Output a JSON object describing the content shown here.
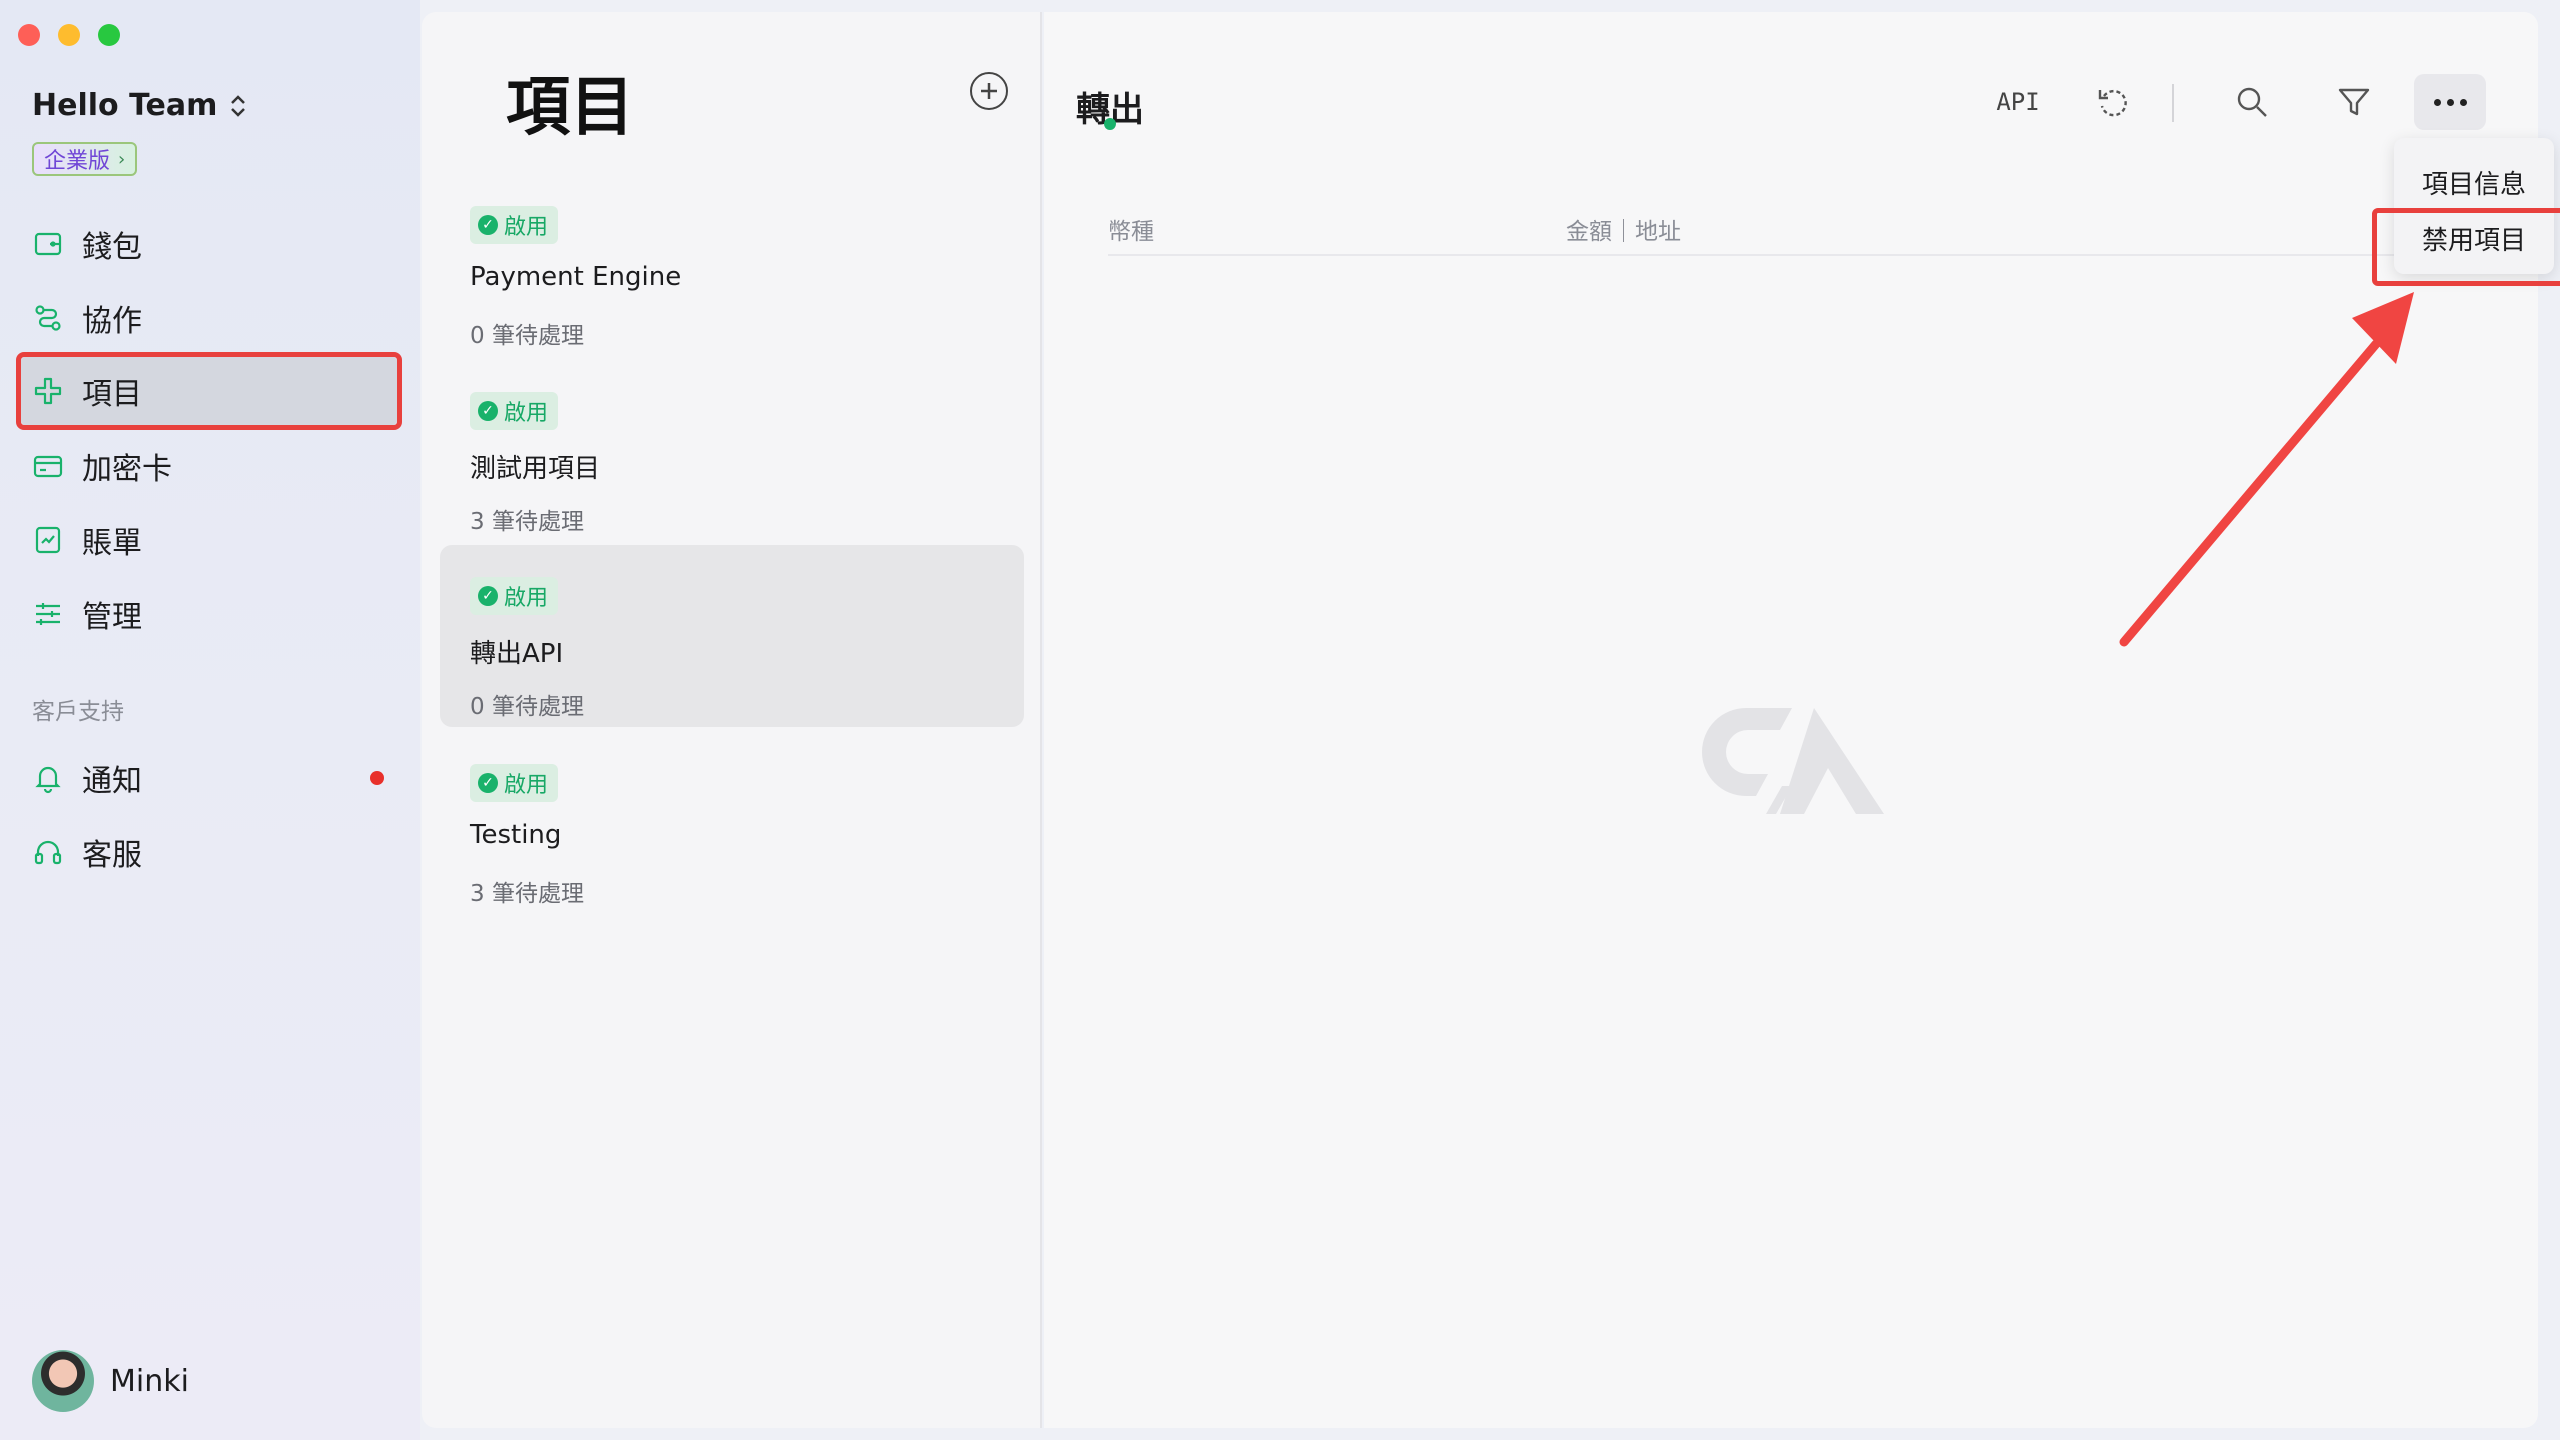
{
  "sidebar": {
    "team_name": "Hello Team",
    "team_chevron": "⌃⌄",
    "plan_badge": "企業版",
    "plan_arrow": "›",
    "nav": [
      {
        "label": "錢包",
        "icon": "wallet-icon"
      },
      {
        "label": "協作",
        "icon": "collaborate-icon"
      },
      {
        "label": "項目",
        "icon": "project-icon",
        "active": true
      },
      {
        "label": "加密卡",
        "icon": "card-icon"
      },
      {
        "label": "賬單",
        "icon": "bill-icon"
      },
      {
        "label": "管理",
        "icon": "settings-sliders-icon"
      }
    ],
    "support_label": "客戶支持",
    "support": [
      {
        "label": "通知",
        "icon": "bell-icon",
        "has_dot": true
      },
      {
        "label": "客服",
        "icon": "headset-icon"
      }
    ],
    "user_name": "Minki"
  },
  "projects": {
    "title": "項目",
    "add_icon": "plus-circle-icon",
    "items": [
      {
        "status": "啟用",
        "name": "Payment Engine",
        "pending": "0 筆待處理"
      },
      {
        "status": "啟用",
        "name": "測試用項目",
        "pending": "3 筆待處理"
      },
      {
        "status": "啟用",
        "name": "轉出API",
        "pending": "0 筆待處理",
        "selected": true
      },
      {
        "status": "啟用",
        "name": "Testing",
        "pending": "3 筆待處理"
      }
    ]
  },
  "content": {
    "tab": "轉出",
    "toolbar": {
      "api_label": "API",
      "icons": [
        "refresh-icon",
        "search-icon",
        "filter-icon",
        "more-icon"
      ]
    },
    "columns": {
      "currency": "幣種",
      "amount_address": "金額｜地址"
    },
    "menu": {
      "items": [
        "項目信息",
        "禁用項目"
      ]
    },
    "watermark": "CA"
  },
  "colors": {
    "accent": "#19b26b",
    "highlight": "#e8403d",
    "notification": "#e8302b"
  }
}
